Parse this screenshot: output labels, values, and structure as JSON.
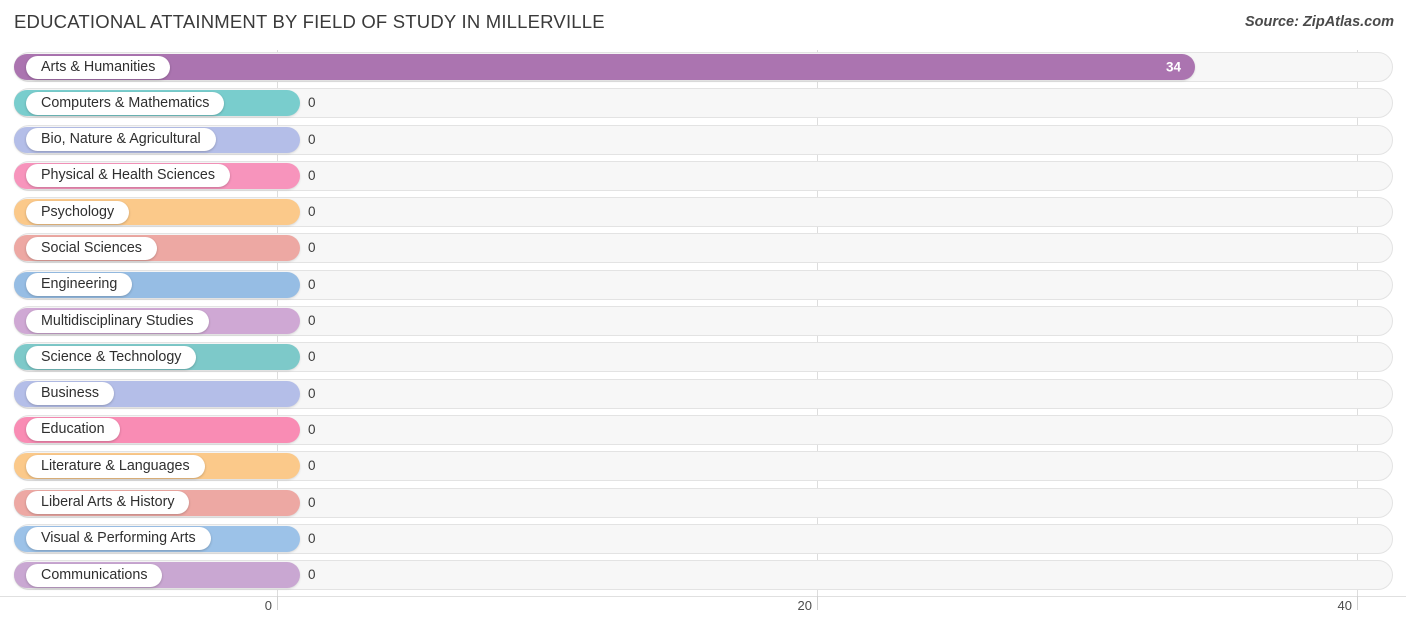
{
  "header": {
    "title": "EDUCATIONAL ATTAINMENT BY FIELD OF STUDY IN MILLERVILLE",
    "source": "Source: ZipAtlas.com"
  },
  "chart_data": {
    "type": "bar",
    "orientation": "horizontal",
    "title": "EDUCATIONAL ATTAINMENT BY FIELD OF STUDY IN MILLERVILLE",
    "xlabel": "",
    "ylabel": "",
    "xlim": [
      0,
      40
    ],
    "grid": true,
    "legend": "none",
    "xticks": [
      "0",
      "20",
      "40"
    ],
    "xtick_values": [
      0,
      20,
      40
    ],
    "categories": [
      "Arts & Humanities",
      "Computers & Mathematics",
      "Bio, Nature & Agricultural",
      "Physical & Health Sciences",
      "Psychology",
      "Social Sciences",
      "Engineering",
      "Multidisciplinary Studies",
      "Science & Technology",
      "Business",
      "Education",
      "Literature & Languages",
      "Liberal Arts & History",
      "Visual & Performing Arts",
      "Communications"
    ],
    "values": [
      34,
      0,
      0,
      0,
      0,
      0,
      0,
      0,
      0,
      0,
      0,
      0,
      0,
      0,
      0
    ],
    "value_labels": [
      "34",
      "0",
      "0",
      "0",
      "0",
      "0",
      "0",
      "0",
      "0",
      "0",
      "0",
      "0",
      "0",
      "0",
      "0"
    ],
    "colors": [
      "#ab74b0",
      "#79cdcd",
      "#b4bee8",
      "#f794bc",
      "#fbc98a",
      "#eda8a3",
      "#96bde4",
      "#cfa8d4",
      "#7dc9c9",
      "#b4bee8",
      "#f98cb4",
      "#fbc98a",
      "#eda8a3",
      "#9cc2e8",
      "#c9a7d2"
    ]
  },
  "rows": [
    {
      "label": "Arts & Humanities",
      "value": 34,
      "value_label": "34",
      "color": "#ab74b0",
      "inside": true
    },
    {
      "label": "Computers & Mathematics",
      "value": 0,
      "value_label": "0",
      "color": "#79cdcd",
      "inside": false
    },
    {
      "label": "Bio, Nature & Agricultural",
      "value": 0,
      "value_label": "0",
      "color": "#b4bee8",
      "inside": false
    },
    {
      "label": "Physical & Health Sciences",
      "value": 0,
      "value_label": "0",
      "color": "#f794bc",
      "inside": false
    },
    {
      "label": "Psychology",
      "value": 0,
      "value_label": "0",
      "color": "#fbc98a",
      "inside": false
    },
    {
      "label": "Social Sciences",
      "value": 0,
      "value_label": "0",
      "color": "#eda8a3",
      "inside": false
    },
    {
      "label": "Engineering",
      "value": 0,
      "value_label": "0",
      "color": "#96bde4",
      "inside": false
    },
    {
      "label": "Multidisciplinary Studies",
      "value": 0,
      "value_label": "0",
      "color": "#cfa8d4",
      "inside": false
    },
    {
      "label": "Science & Technology",
      "value": 0,
      "value_label": "0",
      "color": "#7dc9c9",
      "inside": false
    },
    {
      "label": "Business",
      "value": 0,
      "value_label": "0",
      "color": "#b4bee8",
      "inside": false
    },
    {
      "label": "Education",
      "value": 0,
      "value_label": "0",
      "color": "#f98cb4",
      "inside": false
    },
    {
      "label": "Literature & Languages",
      "value": 0,
      "value_label": "0",
      "color": "#fbc98a",
      "inside": false
    },
    {
      "label": "Liberal Arts & History",
      "value": 0,
      "value_label": "0",
      "color": "#eda8a3",
      "inside": false
    },
    {
      "label": "Visual & Performing Arts",
      "value": 0,
      "value_label": "0",
      "color": "#9cc2e8",
      "inside": false
    },
    {
      "label": "Communications",
      "value": 0,
      "value_label": "0",
      "color": "#c9a7d2",
      "inside": false
    }
  ],
  "axis": {
    "ticks": [
      {
        "label": "0",
        "value": 0
      },
      {
        "label": "20",
        "value": 20
      },
      {
        "label": "40",
        "value": 40
      }
    ]
  }
}
